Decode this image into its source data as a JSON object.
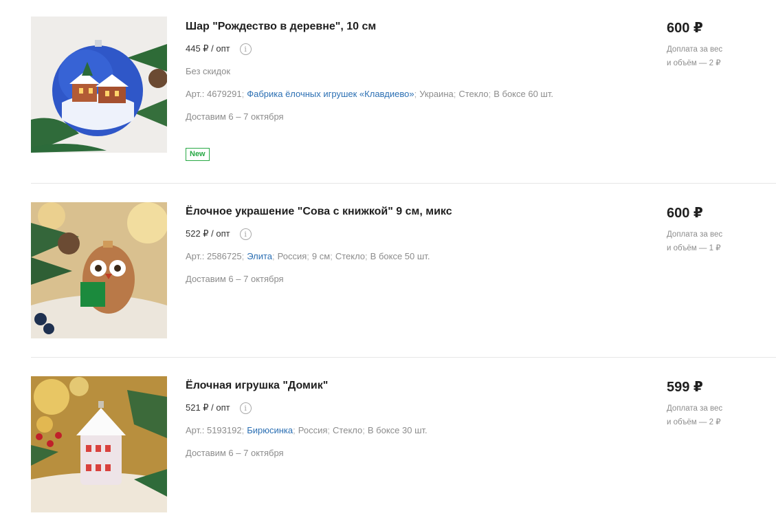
{
  "products": [
    {
      "title": "Шар \"Рождество в деревне\", 10 см",
      "opt_price": "445 ₽ / опт",
      "discount": "Без скидок",
      "sku": "Арт.: 4679291",
      "brand": "Фабрика ёлочных игрушек «Клавдиево»",
      "attrs": [
        "Украина",
        "Стекло",
        "В боксе 60 шт."
      ],
      "delivery": "Доставим 6 – 7 октября",
      "badge": "New",
      "price": "600 ₽",
      "surcharge_line1": "Доплата за вес",
      "surcharge_line2": "и объём — 2 ₽"
    },
    {
      "title": "Ёлочное украшение \"Сова с книжкой\" 9 см, микс",
      "opt_price": "522 ₽ / опт",
      "sku": "Арт.: 2586725",
      "brand": "Элита",
      "attrs": [
        "Россия",
        "9 см",
        "Стекло",
        "В боксе 50 шт."
      ],
      "delivery": "Доставим 6 – 7 октября",
      "price": "600 ₽",
      "surcharge_line1": "Доплата за вес",
      "surcharge_line2": "и объём — 1 ₽"
    },
    {
      "title": "Ёлочная игрушка \"Домик\"",
      "opt_price": "521 ₽ / опт",
      "sku": "Арт.: 5193192",
      "brand": "Бирюсинка",
      "attrs": [
        "Россия",
        "Стекло",
        "В боксе 30 шт."
      ],
      "delivery": "Доставим 6 – 7 октября",
      "price": "599 ₽",
      "surcharge_line1": "Доплата за вес",
      "surcharge_line2": "и объём — 2 ₽"
    }
  ],
  "ui": {
    "info_icon": "info-icon",
    "info_glyph": "i",
    "separator": ";",
    "colors": {
      "link": "#2b6fb3",
      "badge_green": "#27a844",
      "muted_text": "#8c8c8c"
    }
  }
}
